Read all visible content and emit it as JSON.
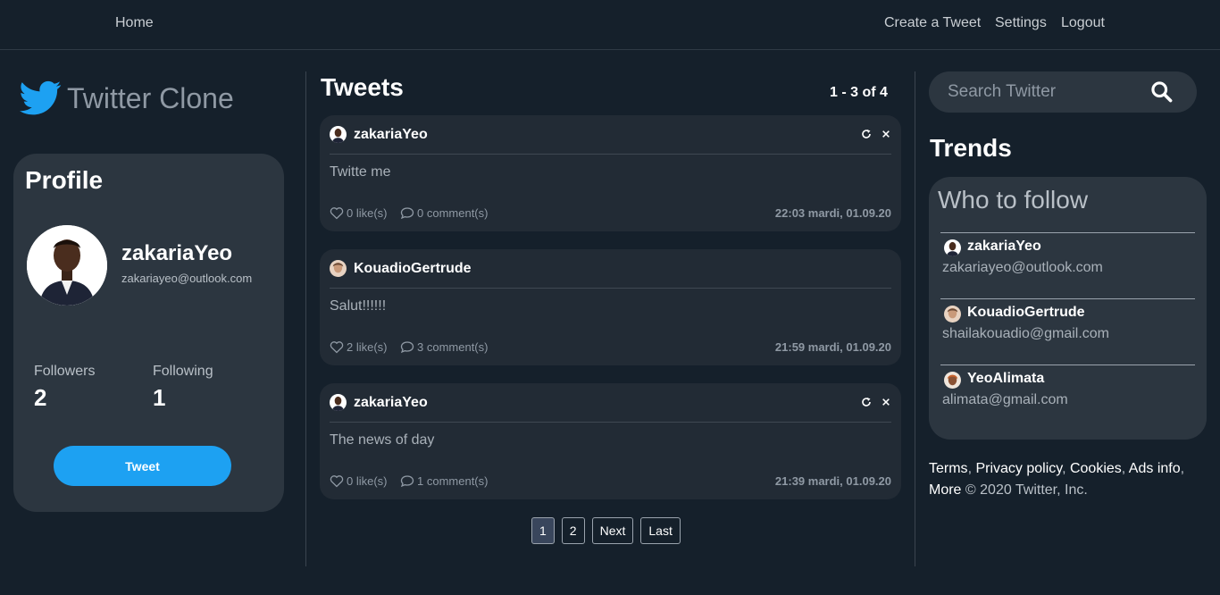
{
  "nav": {
    "home": "Home",
    "create_tweet": "Create a Tweet",
    "settings": "Settings",
    "logout": "Logout"
  },
  "brand": {
    "name": "Twitter Clone",
    "icon": "twitter-bird-icon",
    "color": "#1da1f2"
  },
  "profile": {
    "heading": "Profile",
    "username": "zakariaYeo",
    "email": "zakariayeo@outlook.com",
    "followers_label": "Followers",
    "followers_count": "2",
    "following_label": "Following",
    "following_count": "1",
    "tweet_button": "Tweet"
  },
  "tweets": {
    "heading": "Tweets",
    "range": "1 - 3 of 4",
    "items": [
      {
        "author": "zakariaYeo",
        "text": "Twitte me",
        "likes": "0 like(s)",
        "comments": "0 comment(s)",
        "date": "22:03 mardi, 01.09.20",
        "editable": true
      },
      {
        "author": "KouadioGertrude",
        "text": "Salut!!!!!!",
        "likes": "2 like(s)",
        "comments": "3 comment(s)",
        "date": "21:59 mardi, 01.09.20",
        "editable": false
      },
      {
        "author": "zakariaYeo",
        "text": "The news of day",
        "likes": "0 like(s)",
        "comments": "1 comment(s)",
        "date": "21:39 mardi, 01.09.20",
        "editable": true
      }
    ]
  },
  "pagination": {
    "pages": [
      "1",
      "2"
    ],
    "current": "1",
    "next": "Next",
    "last": "Last"
  },
  "search": {
    "placeholder": "Search Twitter"
  },
  "trends": {
    "heading": "Trends",
    "who_to_follow": "Who to follow",
    "users": [
      {
        "name": "zakariaYeo",
        "email": "zakariayeo@outlook.com"
      },
      {
        "name": "KouadioGertrude",
        "email": "shailakouadio@gmail.com"
      },
      {
        "name": "YeoAlimata",
        "email": "alimata@gmail.com"
      }
    ]
  },
  "footer": {
    "terms": "Terms",
    "privacy": "Privacy policy",
    "cookies": "Cookies",
    "ads": "Ads info",
    "more": "More",
    "copyright": "© 2020 Twitter, Inc."
  },
  "colors": {
    "background": "#15202b",
    "card": "#2c3640",
    "tweet_card": "#222b35",
    "accent": "#1da1f2"
  }
}
